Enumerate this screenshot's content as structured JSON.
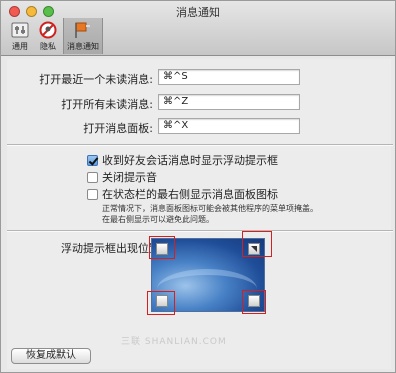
{
  "window": {
    "title": "消息通知",
    "traffic_colors": [
      "#f25a52",
      "#f6b93a",
      "#58c04a"
    ]
  },
  "toolbar": {
    "items": [
      {
        "label": "通用",
        "icon": "switch-icon",
        "selected": false
      },
      {
        "label": "隐私",
        "icon": "privacy-icon",
        "selected": false
      },
      {
        "label": "消息通知",
        "icon": "notification-flag-icon",
        "selected": true
      }
    ]
  },
  "shortcuts": [
    {
      "label": "打开最近一个未读消息:",
      "value": "⌘^S"
    },
    {
      "label": "打开所有未读消息:",
      "value": "⌘^Z"
    },
    {
      "label": "打开消息面板:",
      "value": "⌘^X"
    }
  ],
  "options": [
    {
      "label": "收到好友会话消息时显示浮动提示框",
      "checked": true
    },
    {
      "label": "关闭提示音",
      "checked": false
    },
    {
      "label": "在状态栏的最右侧显示消息面板图标",
      "checked": false
    }
  ],
  "note_lines": [
    "正常情况下，消息面板图标可能会被其他程序的菜单项掩盖。",
    "在最右侧显示可以避免此问题。"
  ],
  "position": {
    "label": "浮动提示框出现位置:",
    "selected_corner": "top-right"
  },
  "restore_button": "恢复成默认",
  "watermark": "三联 SHANLIAN.COM"
}
